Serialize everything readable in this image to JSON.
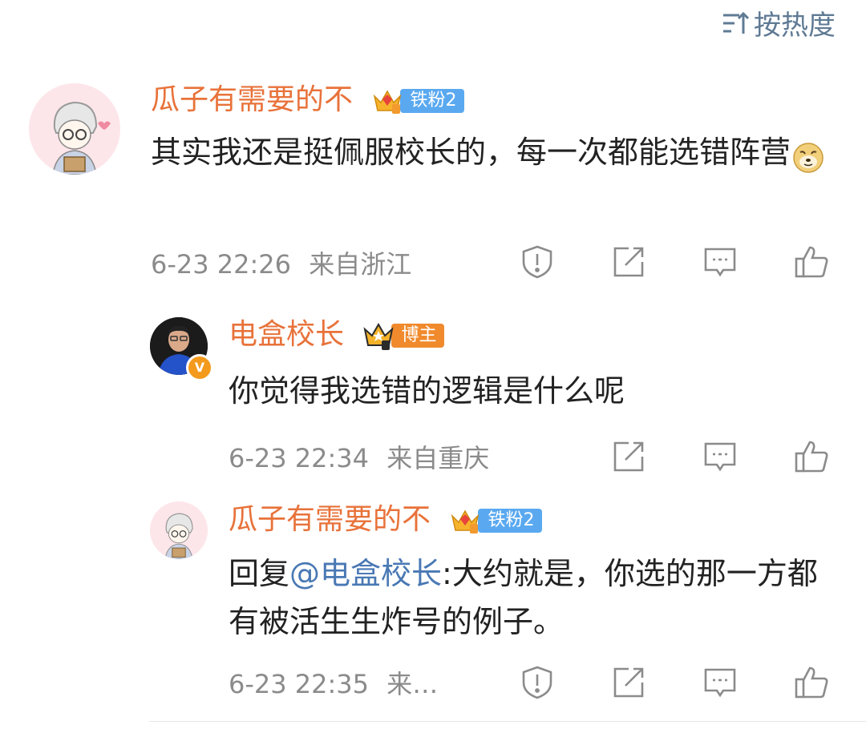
{
  "sort": {
    "label": "按热度"
  },
  "comment": {
    "user": "瓜子有需要的不",
    "badge": "铁粉2",
    "text": "其实我还是挺佩服校长的，每一次都能选错阵营",
    "emoji": "doge-emoji",
    "time": "6-23 22:26",
    "location": "来自浙江"
  },
  "replies": [
    {
      "user": "电盒校长",
      "badge": "博主",
      "verified": "V",
      "text": "你觉得我选错的逻辑是什么呢",
      "time": "6-23 22:34",
      "location": "来自重庆"
    },
    {
      "user": "瓜子有需要的不",
      "badge": "铁粉2",
      "reply_prefix": "回复",
      "mention": "@电盒校长",
      "text": ":大约就是，你选的那一方都有被活生生炸号的例子。",
      "time": "6-23 22:35",
      "location": "来…"
    }
  ],
  "icons": [
    "sort-icon",
    "report-icon",
    "share-icon",
    "comment-icon",
    "like-icon",
    "crown-icon",
    "verified-icon"
  ],
  "colors": {
    "name": "#e8723a",
    "mention": "#4978b4",
    "fan_badge": "#5aa9f0",
    "host_badge": "#f08a2c",
    "meta": "#8b8b8b"
  }
}
